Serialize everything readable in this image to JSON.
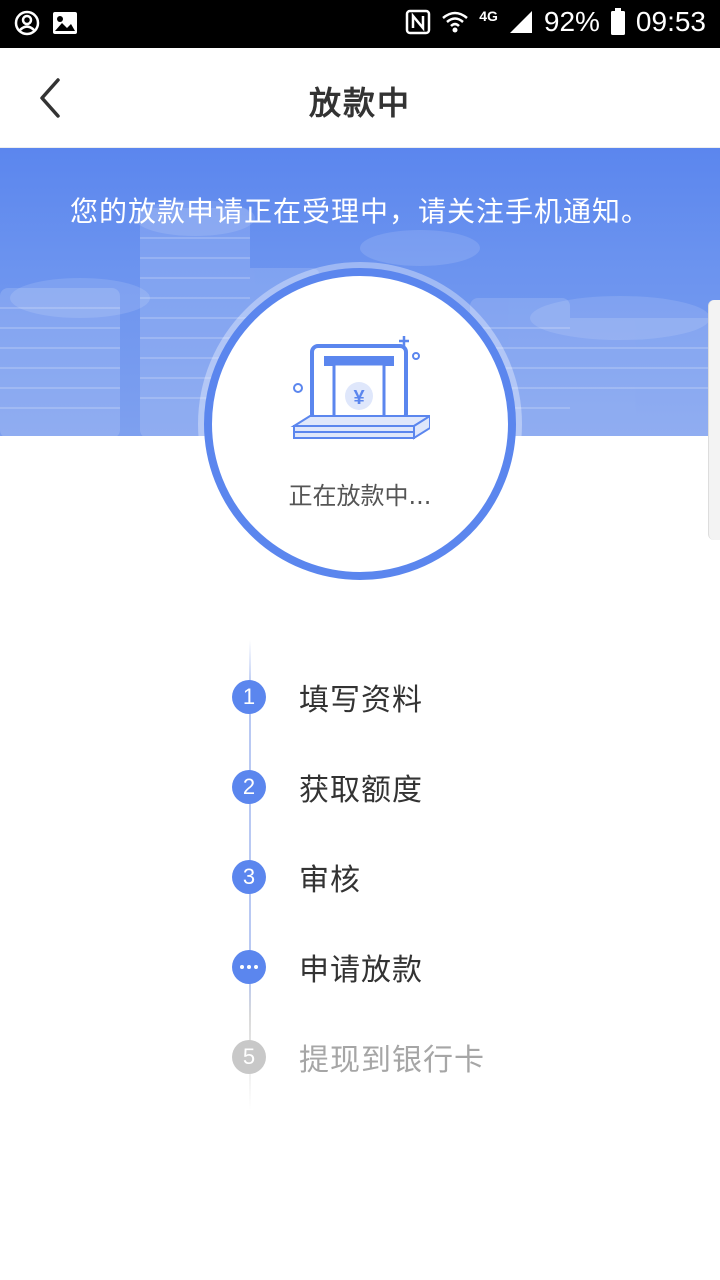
{
  "status_bar": {
    "battery": "92%",
    "time": "09:53",
    "network": "4G",
    "icons": [
      "account-circle-icon",
      "image-icon",
      "nfc-icon",
      "wifi-icon",
      "signal-icon",
      "battery-icon"
    ]
  },
  "header": {
    "title": "放款中",
    "back_icon": "chevron-left-icon"
  },
  "banner": {
    "message": "您的放款申请正在受理中，请关注手机通知。"
  },
  "status_card": {
    "caption": "正在放款中...",
    "icon": "atm-cash-icon",
    "currency_symbol": "¥"
  },
  "steps": [
    {
      "marker": "1",
      "label": "填写资料",
      "state": "done"
    },
    {
      "marker": "2",
      "label": "获取额度",
      "state": "done"
    },
    {
      "marker": "3",
      "label": "审核",
      "state": "done"
    },
    {
      "marker": "",
      "label": "申请放款",
      "state": "current"
    },
    {
      "marker": "5",
      "label": "提现到银行卡",
      "state": "pending"
    }
  ],
  "colors": {
    "accent": "#5b86ee",
    "pending": "#c8c8c8",
    "text": "#333333"
  }
}
